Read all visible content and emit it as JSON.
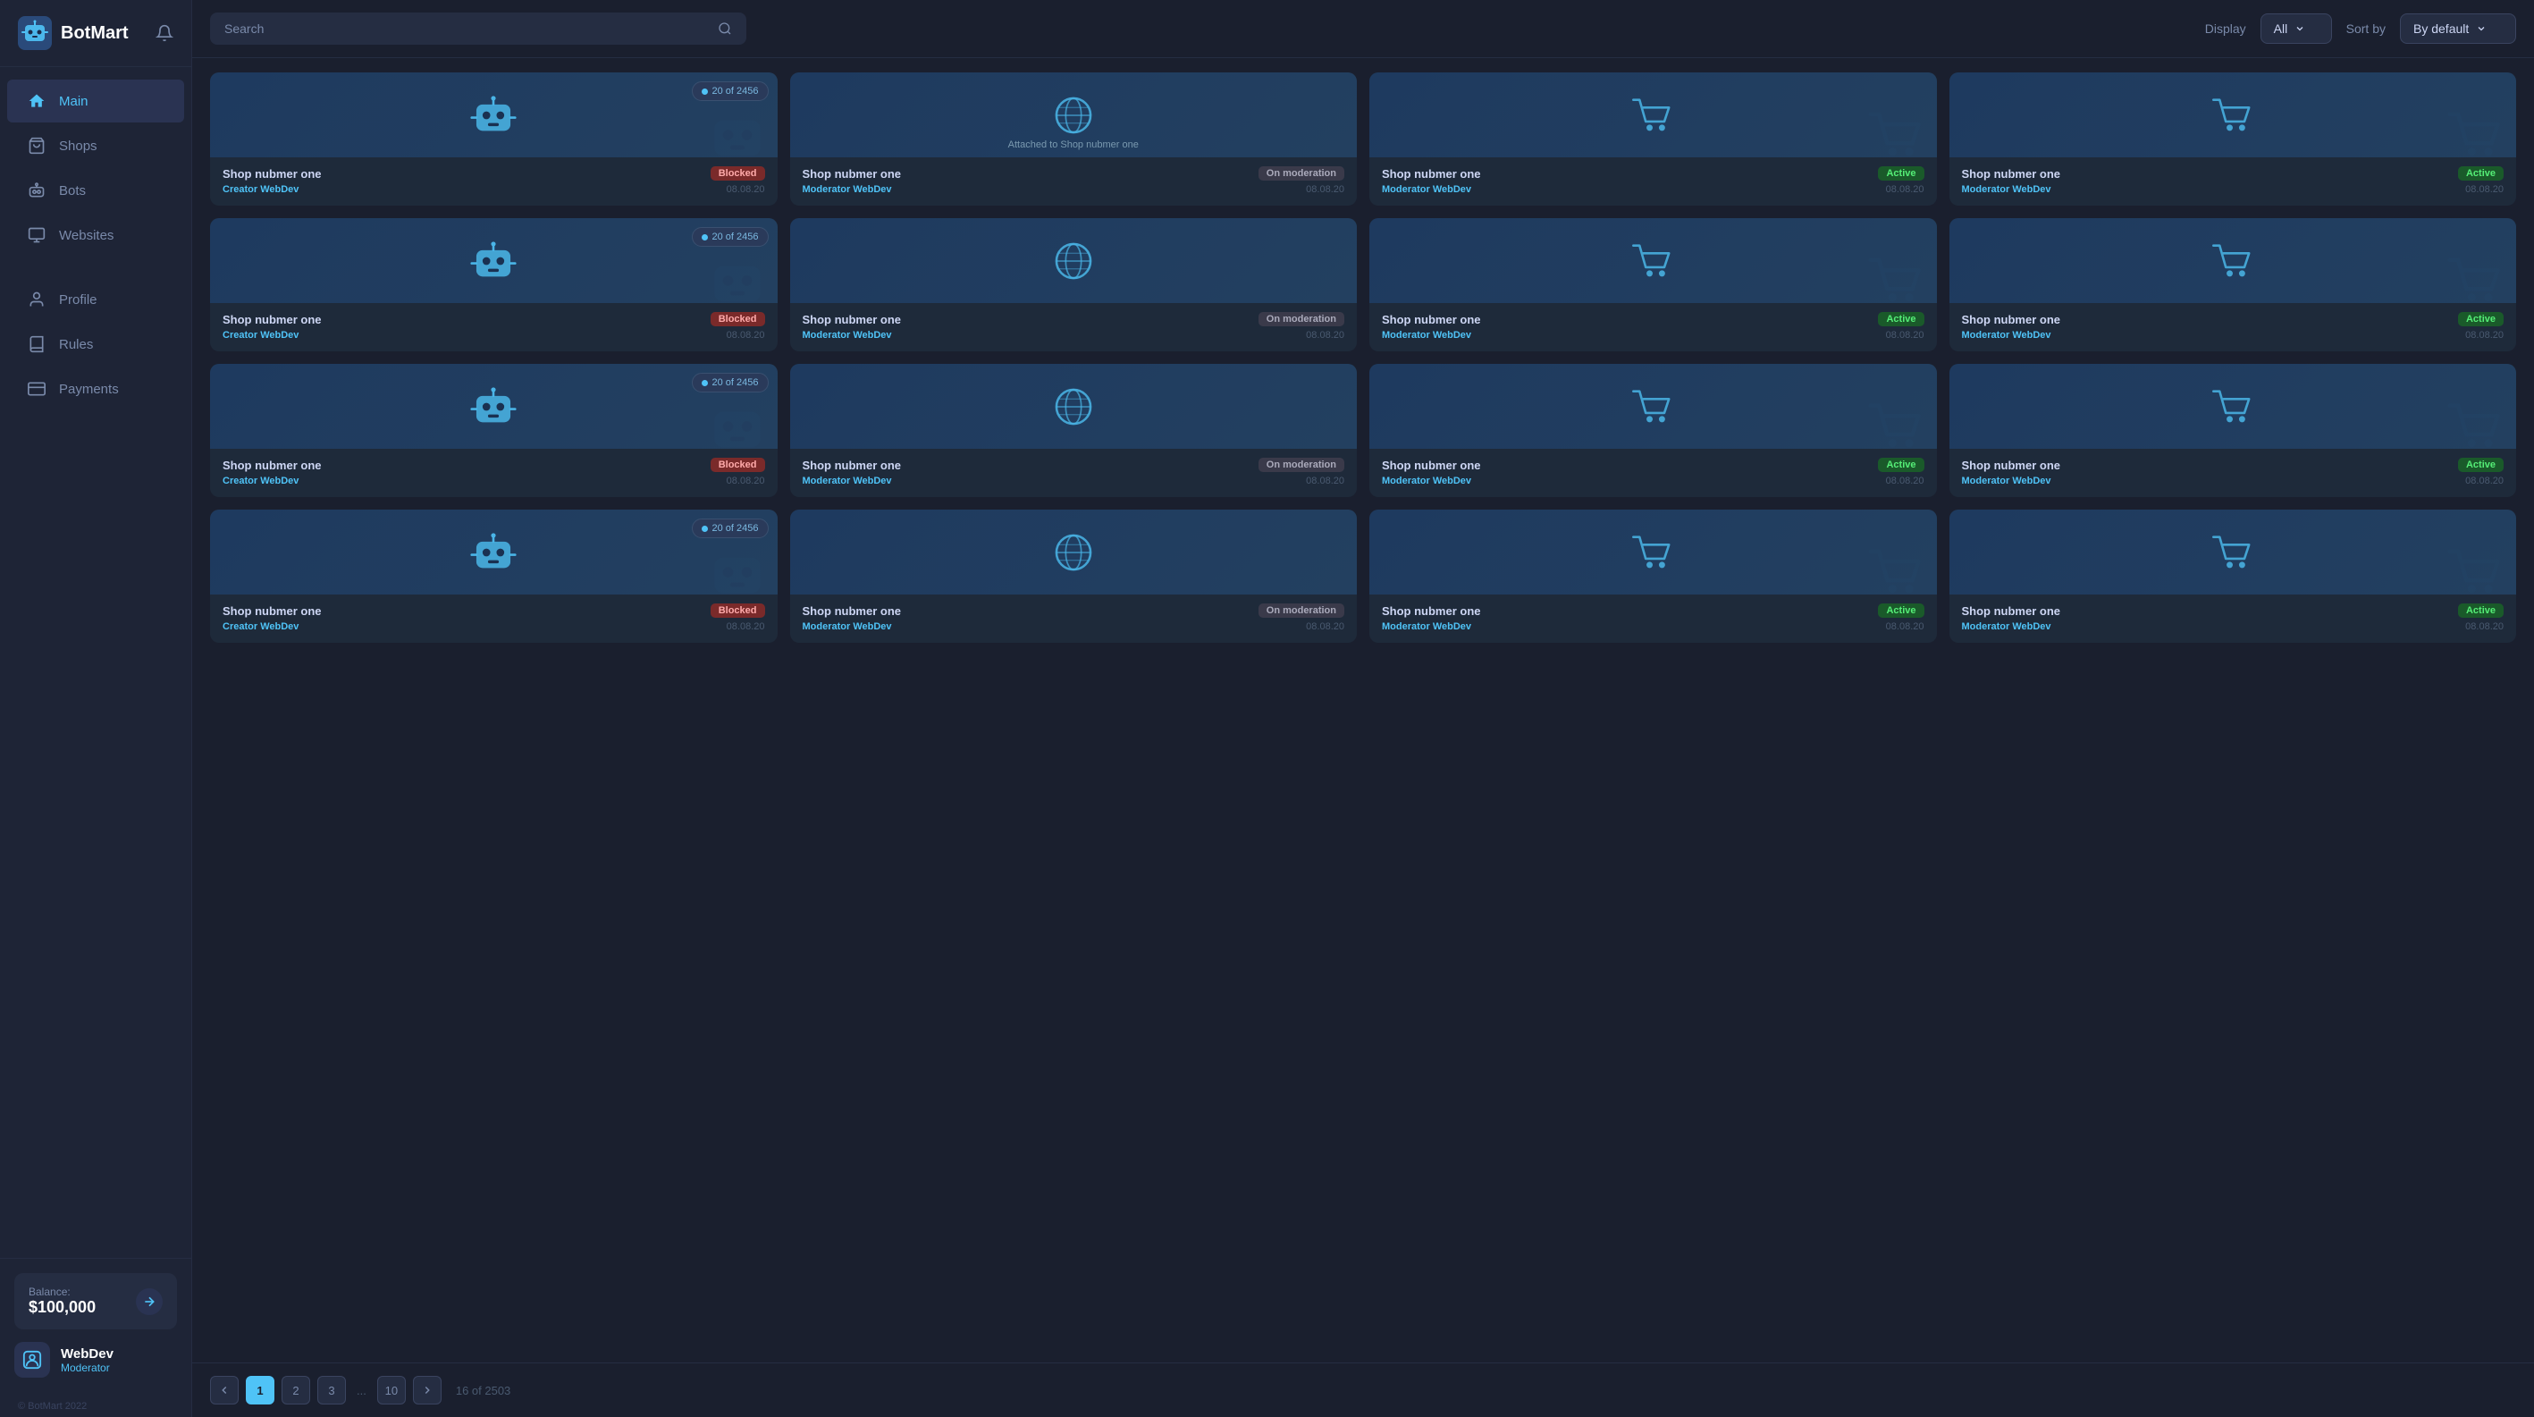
{
  "app": {
    "name": "BotMart",
    "copyright": "© BotMart 2022"
  },
  "sidebar": {
    "nav_items": [
      {
        "id": "main",
        "label": "Main",
        "active": true
      },
      {
        "id": "shops",
        "label": "Shops",
        "active": false
      },
      {
        "id": "bots",
        "label": "Bots",
        "active": false
      },
      {
        "id": "websites",
        "label": "Websites",
        "active": false
      },
      {
        "id": "profile",
        "label": "Profile",
        "active": false
      },
      {
        "id": "rules",
        "label": "Rules",
        "active": false
      },
      {
        "id": "payments",
        "label": "Payments",
        "active": false
      }
    ],
    "balance": {
      "label": "Balance:",
      "amount": "$100,000"
    },
    "user": {
      "name": "WebDev",
      "role": "Moderator"
    }
  },
  "topbar": {
    "search_placeholder": "Search",
    "display_label": "Display",
    "display_value": "All",
    "sort_label": "Sort by",
    "sort_value": "By default"
  },
  "cards": [
    {
      "id": 1,
      "title": "Shop nubmer one",
      "status": "Blocked",
      "creator_type": "Creator",
      "creator": "WebDev",
      "date": "08.08.20",
      "icon": "bot",
      "badge": "20 of 2456"
    },
    {
      "id": 2,
      "title": "Shop nubmer one",
      "status": "On moderation",
      "creator_type": "Moderator",
      "creator": "WebDev",
      "date": "08.08.20",
      "icon": "globe",
      "subtitle": "Attached to Shop nubmer one"
    },
    {
      "id": 3,
      "title": "Shop nubmer one",
      "status": "Active",
      "creator_type": "Moderator",
      "creator": "WebDev",
      "date": "08.08.20",
      "icon": "cart"
    },
    {
      "id": 4,
      "title": "Shop nubmer one",
      "status": "Active",
      "creator_type": "Moderator",
      "creator": "WebDev",
      "date": "08.08.20",
      "icon": "cart"
    },
    {
      "id": 5,
      "title": "Shop nubmer one",
      "status": "Blocked",
      "creator_type": "Creator",
      "creator": "WebDev",
      "date": "08.08.20",
      "icon": "bot",
      "badge": "20 of 2456"
    },
    {
      "id": 6,
      "title": "Shop nubmer one",
      "status": "On moderation",
      "creator_type": "Moderator",
      "creator": "WebDev",
      "date": "08.08.20",
      "icon": "globe"
    },
    {
      "id": 7,
      "title": "Shop nubmer one",
      "status": "Active",
      "creator_type": "Moderator",
      "creator": "WebDev",
      "date": "08.08.20",
      "icon": "cart"
    },
    {
      "id": 8,
      "title": "Shop nubmer one",
      "status": "Active",
      "creator_type": "Moderator",
      "creator": "WebDev",
      "date": "08.08.20",
      "icon": "cart"
    },
    {
      "id": 9,
      "title": "Shop nubmer one",
      "status": "Blocked",
      "creator_type": "Creator",
      "creator": "WebDev",
      "date": "08.08.20",
      "icon": "bot",
      "badge": "20 of 2456"
    },
    {
      "id": 10,
      "title": "Shop nubmer one",
      "status": "On moderation",
      "creator_type": "Moderator",
      "creator": "WebDev",
      "date": "08.08.20",
      "icon": "globe"
    },
    {
      "id": 11,
      "title": "Shop nubmer one",
      "status": "Active",
      "creator_type": "Moderator",
      "creator": "WebDev",
      "date": "08.08.20",
      "icon": "cart"
    },
    {
      "id": 12,
      "title": "Shop nubmer one",
      "status": "Active",
      "creator_type": "Moderator",
      "creator": "WebDev",
      "date": "08.08.20",
      "icon": "cart"
    },
    {
      "id": 13,
      "title": "Shop nubmer one",
      "status": "Blocked",
      "creator_type": "Creator",
      "creator": "WebDev",
      "date": "08.08.20",
      "icon": "bot",
      "badge": "20 of 2456"
    },
    {
      "id": 14,
      "title": "Shop nubmer one",
      "status": "On moderation",
      "creator_type": "Moderator",
      "creator": "WebDev",
      "date": "08.08.20",
      "icon": "globe"
    },
    {
      "id": 15,
      "title": "Shop nubmer one",
      "status": "Active",
      "creator_type": "Moderator",
      "creator": "WebDev",
      "date": "08.08.20",
      "icon": "cart"
    },
    {
      "id": 16,
      "title": "Shop nubmer one",
      "status": "Active",
      "creator_type": "Moderator",
      "creator": "WebDev",
      "date": "08.08.20",
      "icon": "cart"
    }
  ],
  "pagination": {
    "prev_label": "‹",
    "next_label": "›",
    "pages": [
      "1",
      "2",
      "3",
      "...",
      "10"
    ],
    "current": "1",
    "total_text": "16 of 2503"
  }
}
